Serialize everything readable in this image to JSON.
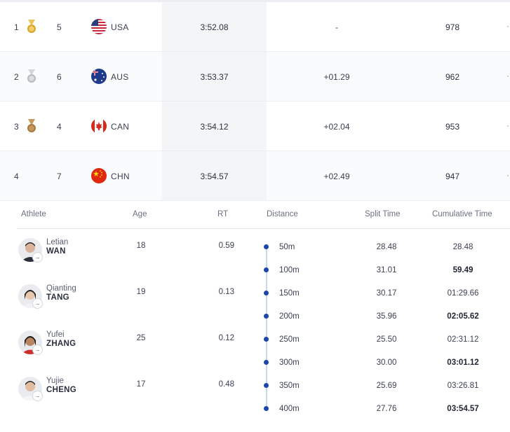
{
  "results": [
    {
      "rank": "1",
      "medal": "gold",
      "lane": "5",
      "country": "USA",
      "flag_icon": "usa-flag-icon",
      "time": "3:52.08",
      "behind": "-",
      "points": "978"
    },
    {
      "rank": "2",
      "medal": "silver",
      "lane": "6",
      "country": "AUS",
      "flag_icon": "aus-flag-icon",
      "time": "3:53.37",
      "behind": "+01.29",
      "points": "962"
    },
    {
      "rank": "3",
      "medal": "bronze",
      "lane": "4",
      "country": "CAN",
      "flag_icon": "can-flag-icon",
      "time": "3:54.12",
      "behind": "+02.04",
      "points": "953"
    },
    {
      "rank": "4",
      "medal": "",
      "lane": "7",
      "country": "CHN",
      "flag_icon": "chn-flag-icon",
      "time": "3:54.57",
      "behind": "+02.49",
      "points": "947"
    }
  ],
  "detail": {
    "headers": {
      "athlete": "Athlete",
      "age": "Age",
      "rt": "RT",
      "distance": "Distance",
      "split": "Split Time",
      "cumulative": "Cumulative Time"
    },
    "athletes": [
      {
        "first": "Letian",
        "last": "WAN",
        "age": "18",
        "rt": "0.59"
      },
      {
        "first": "Qianting",
        "last": "TANG",
        "age": "19",
        "rt": "0.13"
      },
      {
        "first": "Yufei",
        "last": "ZHANG",
        "age": "25",
        "rt": "0.12"
      },
      {
        "first": "Yujie",
        "last": "CHENG",
        "age": "17",
        "rt": "0.48"
      }
    ],
    "splits": [
      {
        "distance": "50m",
        "split": "28.48",
        "cumulative": "28.48"
      },
      {
        "distance": "100m",
        "split": "31.01",
        "cumulative": "59.49"
      },
      {
        "distance": "150m",
        "split": "30.17",
        "cumulative": "01:29.66"
      },
      {
        "distance": "200m",
        "split": "35.96",
        "cumulative": "02:05.62"
      },
      {
        "distance": "250m",
        "split": "25.50",
        "cumulative": "02:31.12"
      },
      {
        "distance": "300m",
        "split": "30.00",
        "cumulative": "03:01.12"
      },
      {
        "distance": "350m",
        "split": "25.69",
        "cumulative": "03:26.81"
      },
      {
        "distance": "400m",
        "split": "27.76",
        "cumulative": "03:54.57"
      }
    ]
  },
  "colors": {
    "gold": "#d9a52c",
    "silver": "#b9bcc2",
    "bronze": "#a87b3f",
    "accent": "#1b47a8"
  },
  "icons": {
    "expand": "link-arrow-icon"
  }
}
